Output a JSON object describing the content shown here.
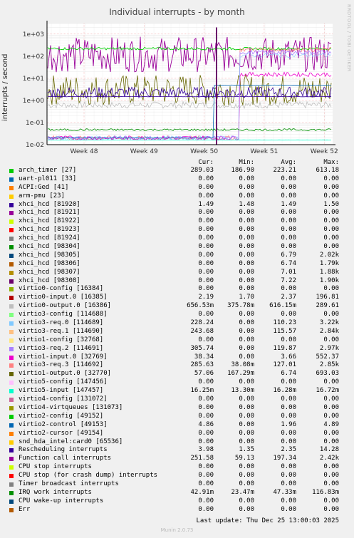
{
  "title": "Individual interrupts - by month",
  "side_text": "RRDTOOL / TOBI OETIKER",
  "ylabel": "interrupts / second",
  "columns": {
    "cur": "Cur:",
    "min": "Min:",
    "avg": "Avg:",
    "max": "Max:"
  },
  "chart_data": {
    "type": "line",
    "title": "Individual interrupts - by month",
    "ylabel": "interrupts / second",
    "yscale": "log",
    "ylim": [
      0.01,
      3000
    ],
    "y_ticks": [
      "1e-02",
      "1e-01",
      "1e+00",
      "1e+01",
      "1e+02",
      "1e+03"
    ],
    "x_ticks": [
      "Week 48",
      "Week 49",
      "Week 50",
      "Week 51",
      "Week 52"
    ],
    "grid": true
  },
  "series": [
    {
      "label": "arch_timer [27]",
      "color": "#00cc00",
      "cur": "289.03",
      "min": "186.90",
      "avg": "223.21",
      "max": "613.18"
    },
    {
      "label": "uart-pl011 [33]",
      "color": "#0066b3",
      "cur": "0.00",
      "min": "0.00",
      "avg": "0.00",
      "max": "0.00"
    },
    {
      "label": "ACPI:Ged [41]",
      "color": "#ff8000",
      "cur": "0.00",
      "min": "0.00",
      "avg": "0.00",
      "max": "0.00"
    },
    {
      "label": "arm-pmu [23]",
      "color": "#ffcc00",
      "cur": "0.00",
      "min": "0.00",
      "avg": "0.00",
      "max": "0.00"
    },
    {
      "label": "xhci_hcd [81920]",
      "color": "#330099",
      "cur": "1.49",
      "min": "1.48",
      "avg": "1.49",
      "max": "1.50"
    },
    {
      "label": "xhci_hcd [81921]",
      "color": "#990099",
      "cur": "0.00",
      "min": "0.00",
      "avg": "0.00",
      "max": "0.00"
    },
    {
      "label": "xhci_hcd [81922]",
      "color": "#ccff00",
      "cur": "0.00",
      "min": "0.00",
      "avg": "0.00",
      "max": "0.00"
    },
    {
      "label": "xhci_hcd [81923]",
      "color": "#ff0000",
      "cur": "0.00",
      "min": "0.00",
      "avg": "0.00",
      "max": "0.00"
    },
    {
      "label": "xhci_hcd [81924]",
      "color": "#808080",
      "cur": "0.00",
      "min": "0.00",
      "avg": "0.00",
      "max": "0.00"
    },
    {
      "label": "xhci_hcd [98304]",
      "color": "#008f00",
      "cur": "0.00",
      "min": "0.00",
      "avg": "0.00",
      "max": "0.00"
    },
    {
      "label": "xhci_hcd [98305]",
      "color": "#00487d",
      "cur": "0.00",
      "min": "0.00",
      "avg": "6.79",
      "max": "2.02k"
    },
    {
      "label": "xhci_hcd [98306]",
      "color": "#b35a00",
      "cur": "0.00",
      "min": "0.00",
      "avg": "6.74",
      "max": "1.79k"
    },
    {
      "label": "xhci_hcd [98307]",
      "color": "#b38f00",
      "cur": "0.00",
      "min": "0.00",
      "avg": "7.01",
      "max": "1.88k"
    },
    {
      "label": "xhci_hcd [98308]",
      "color": "#6b006b",
      "cur": "0.00",
      "min": "0.00",
      "avg": "7.22",
      "max": "1.90k"
    },
    {
      "label": "virtio0-config [16384]",
      "color": "#8fb300",
      "cur": "0.00",
      "min": "0.00",
      "avg": "0.00",
      "max": "0.00"
    },
    {
      "label": "virtio0-input.0 [16385]",
      "color": "#b30000",
      "cur": "2.19",
      "min": "1.70",
      "avg": "2.37",
      "max": "196.81"
    },
    {
      "label": "virtio0-output.0 [16386]",
      "color": "#bebebe",
      "cur": "656.53m",
      "min": "375.78m",
      "avg": "616.15m",
      "max": "289.61"
    },
    {
      "label": "virtio3-config [114688]",
      "color": "#80ff80",
      "cur": "0.00",
      "min": "0.00",
      "avg": "0.00",
      "max": "0.00"
    },
    {
      "label": "virtio3-req.0 [114689]",
      "color": "#80c9ff",
      "cur": "228.24",
      "min": "0.00",
      "avg": "110.23",
      "max": "3.22k"
    },
    {
      "label": "virtio3-req.1 [114690]",
      "color": "#ffc080",
      "cur": "243.68",
      "min": "0.00",
      "avg": "115.57",
      "max": "2.84k"
    },
    {
      "label": "virtio1-config [32768]",
      "color": "#ffe680",
      "cur": "0.00",
      "min": "0.00",
      "avg": "0.00",
      "max": "0.00"
    },
    {
      "label": "virtio3-req.2 [114691]",
      "color": "#aa80ff",
      "cur": "305.74",
      "min": "0.00",
      "avg": "119.87",
      "max": "2.97k"
    },
    {
      "label": "virtio1-input.0 [32769]",
      "color": "#ee00cc",
      "cur": "38.34",
      "min": "0.00",
      "avg": "3.66",
      "max": "552.37"
    },
    {
      "label": "virtio3-req.3 [114692]",
      "color": "#ff8080",
      "cur": "285.63",
      "min": "38.08m",
      "avg": "127.01",
      "max": "2.85k"
    },
    {
      "label": "virtio1-output.0 [32770]",
      "color": "#666600",
      "cur": "57.06",
      "min": "167.29m",
      "avg": "6.74",
      "max": "693.03"
    },
    {
      "label": "virtio5-config [147456]",
      "color": "#ffbfff",
      "cur": "0.00",
      "min": "0.00",
      "avg": "0.00",
      "max": "0.00"
    },
    {
      "label": "virtio5-input [147457]",
      "color": "#00ffcc",
      "cur": "16.25m",
      "min": "13.30m",
      "avg": "16.28m",
      "max": "16.72m"
    },
    {
      "label": "virtio4-config [131072]",
      "color": "#cc6699",
      "cur": "0.00",
      "min": "0.00",
      "avg": "0.00",
      "max": "0.00"
    },
    {
      "label": "virtio4-virtqueues [131073]",
      "color": "#999900",
      "cur": "0.00",
      "min": "0.00",
      "avg": "0.00",
      "max": "0.00"
    },
    {
      "label": "virtio2-config [49152]",
      "color": "#00cc00",
      "cur": "0.00",
      "min": "0.00",
      "avg": "0.00",
      "max": "0.00"
    },
    {
      "label": "virtio2-control [49153]",
      "color": "#0066b3",
      "cur": "4.86",
      "min": "0.00",
      "avg": "1.96",
      "max": "4.89"
    },
    {
      "label": "virtio2-cursor [49154]",
      "color": "#ff8000",
      "cur": "0.00",
      "min": "0.00",
      "avg": "0.00",
      "max": "0.00"
    },
    {
      "label": "snd_hda_intel:card0 [65536]",
      "color": "#ffcc00",
      "cur": "0.00",
      "min": "0.00",
      "avg": "0.00",
      "max": "0.00"
    },
    {
      "label": "Rescheduling interrupts",
      "color": "#330099",
      "cur": "3.98",
      "min": "1.35",
      "avg": "2.35",
      "max": "14.28"
    },
    {
      "label": "Function call interrupts",
      "color": "#990099",
      "cur": "251.58",
      "min": "59.13",
      "avg": "197.34",
      "max": "2.42k"
    },
    {
      "label": "CPU stop interrupts",
      "color": "#ccff00",
      "cur": "0.00",
      "min": "0.00",
      "avg": "0.00",
      "max": "0.00"
    },
    {
      "label": "CPU stop (for crash dump) interrupts",
      "color": "#ff0000",
      "cur": "0.00",
      "min": "0.00",
      "avg": "0.00",
      "max": "0.00"
    },
    {
      "label": "Timer broadcast interrupts",
      "color": "#808080",
      "cur": "0.00",
      "min": "0.00",
      "avg": "0.00",
      "max": "0.00"
    },
    {
      "label": "IRQ work interrupts",
      "color": "#008f00",
      "cur": "42.91m",
      "min": "23.47m",
      "avg": "47.33m",
      "max": "116.83m"
    },
    {
      "label": "CPU wake-up interrupts",
      "color": "#00487d",
      "cur": "0.00",
      "min": "0.00",
      "avg": "0.00",
      "max": "0.00"
    },
    {
      "label": "Err",
      "color": "#b35a00",
      "cur": "0.00",
      "min": "0.00",
      "avg": "0.00",
      "max": "0.00"
    }
  ],
  "last_update": "Last update: Thu Dec 25 13:00:03 2025",
  "footer": "Munin 2.0.73"
}
